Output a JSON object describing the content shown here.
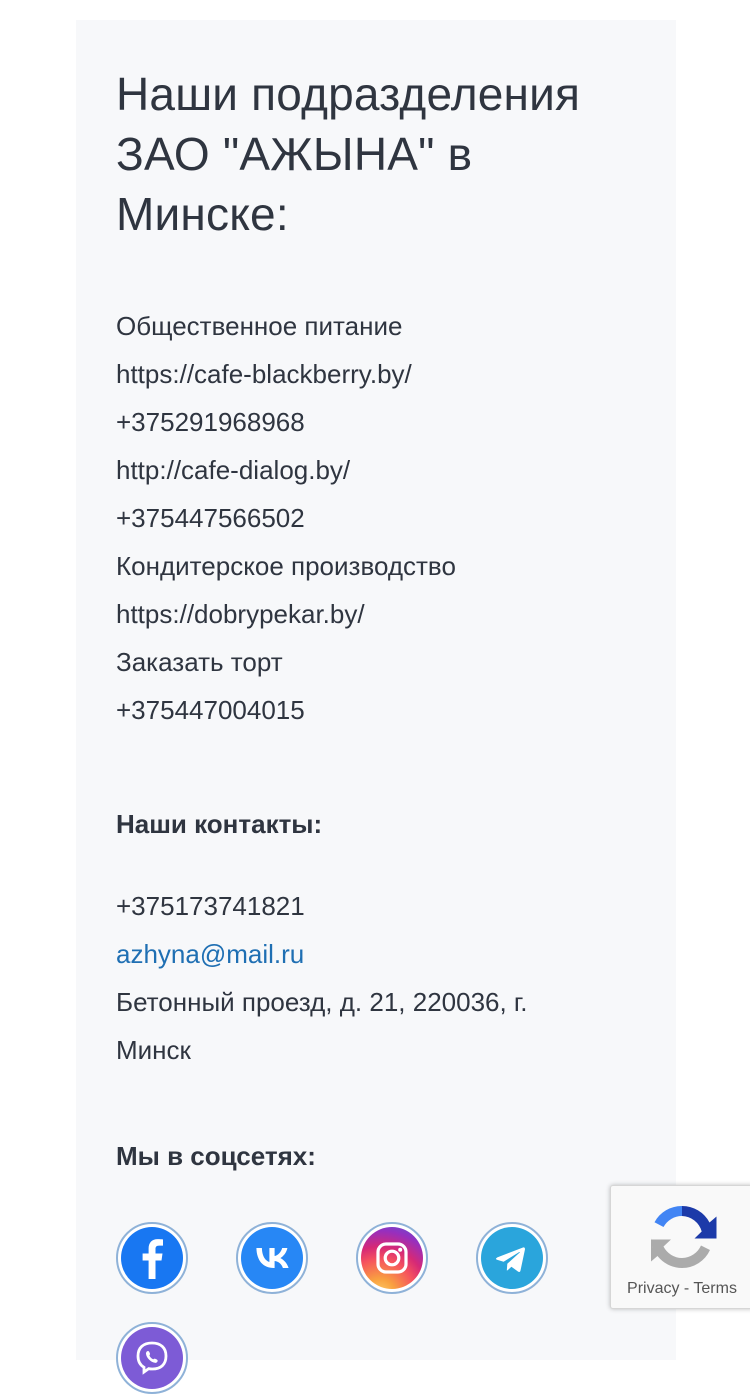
{
  "title": "Наши подразделения ЗАО \"АЖЫНА\" в Минске:",
  "divisions": [
    "Общественное питание",
    "https://cafe-blackberry.by/",
    "+375291968968",
    "http://cafe-dialog.by/",
    "+375447566502",
    "Кондитерское производство",
    "https://dobrypekar.by/",
    "Заказать торт",
    "+375447004015"
  ],
  "contacts": {
    "heading": "Наши контакты:",
    "phone": "+375173741821",
    "email": "azhyna@mail.ru",
    "address": "Бетонный проезд, д. 21, 220036, г. Минск"
  },
  "social": {
    "heading": "Мы в соцсетях:",
    "icons": [
      "facebook-icon",
      "vk-icon",
      "instagram-icon",
      "telegram-icon",
      "viber-icon"
    ]
  },
  "recaptcha": {
    "privacy": "Privacy",
    "separator": "-",
    "terms": "Terms"
  },
  "colors": {
    "text": "#2f3540",
    "link": "#1f6fb3",
    "card_bg": "#f7f8fa"
  }
}
